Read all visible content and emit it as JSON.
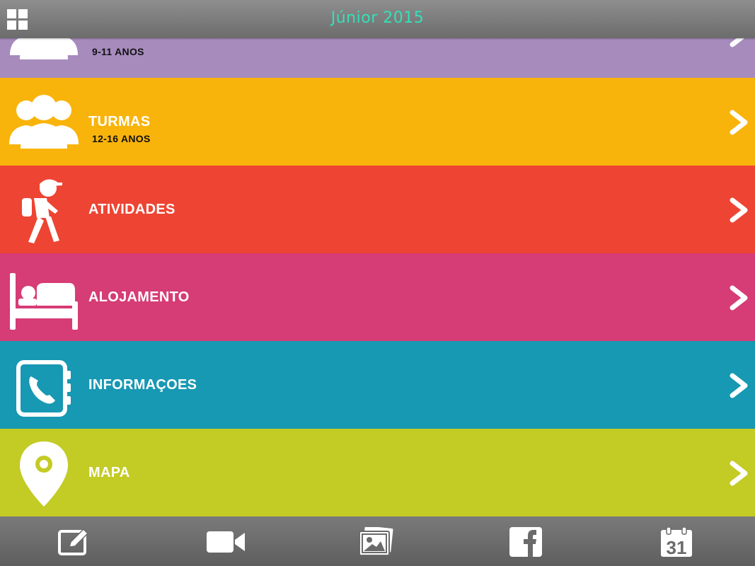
{
  "header": {
    "title": "Júnior 2015",
    "title_color": "#35e0b8"
  },
  "rows": [
    {
      "id": "turmas-9-11",
      "label": "",
      "sub": "9-11 ANOS",
      "color": "#a78bbd",
      "icon": "group-icon"
    },
    {
      "id": "turmas-12-16",
      "label": "TURMAS",
      "sub": "12-16 ANOS",
      "color": "#f9b40b",
      "icon": "group-icon"
    },
    {
      "id": "atividades",
      "label": "ATIVIDADES",
      "sub": "",
      "color": "#ee4433",
      "icon": "hiker-icon"
    },
    {
      "id": "alojamento",
      "label": "ALOJAMENTO",
      "sub": "",
      "color": "#d63c75",
      "icon": "bed-icon"
    },
    {
      "id": "informacoes",
      "label": "INFORMAÇOES",
      "sub": "",
      "color": "#1798b3",
      "icon": "phonebook-icon"
    },
    {
      "id": "mapa",
      "label": "MAPA",
      "sub": "",
      "color": "#c3cb25",
      "icon": "map-pin-icon"
    }
  ],
  "toolbar": [
    "edit-icon",
    "video-camera-icon",
    "photos-icon",
    "facebook-icon",
    "calendar-icon"
  ],
  "calendar_day": "31"
}
